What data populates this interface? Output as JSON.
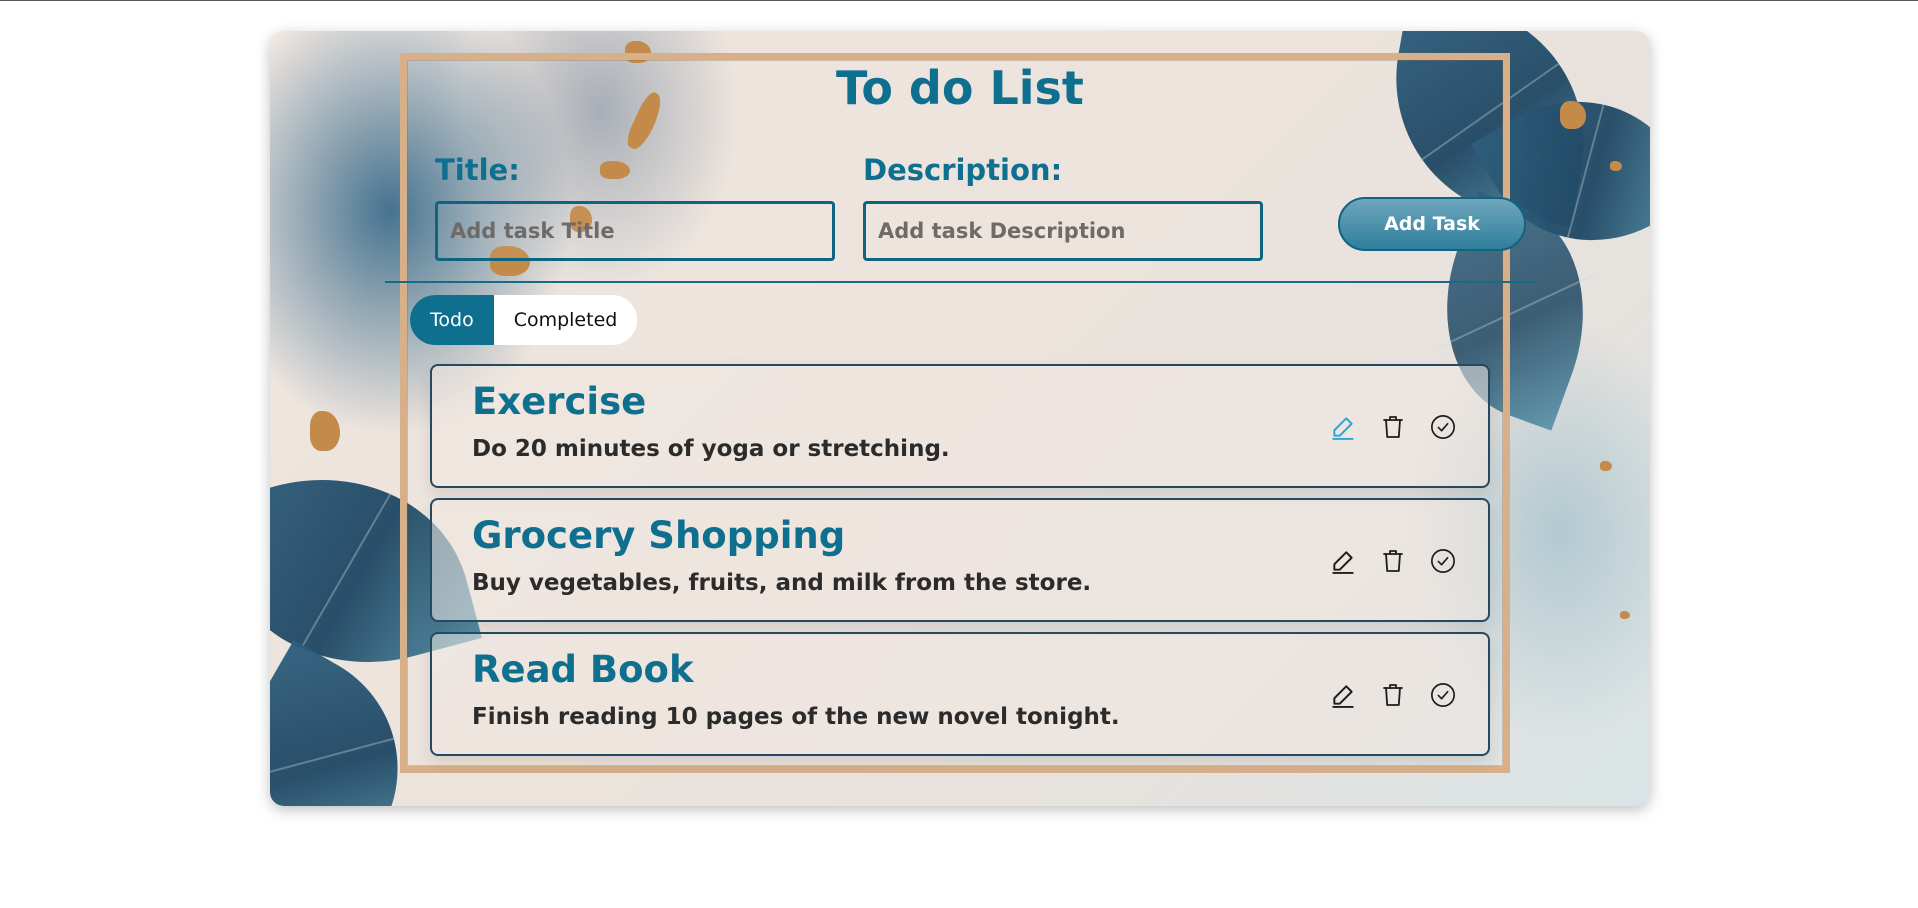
{
  "app": {
    "title": "To do List"
  },
  "form": {
    "title_label": "Title:",
    "title_placeholder": "Add task Title",
    "description_label": "Description:",
    "description_placeholder": "Add task Description",
    "add_button_label": "Add Task"
  },
  "tabs": [
    {
      "label": "Todo",
      "active": true
    },
    {
      "label": "Completed",
      "active": false
    }
  ],
  "tasks": [
    {
      "title": "Exercise",
      "description": "Do 20 minutes of yoga or stretching.",
      "actions": [
        "edit-icon",
        "trash-icon",
        "check-circle-icon"
      ]
    },
    {
      "title": "Grocery Shopping",
      "description": "Buy vegetables, fruits, and milk from the store.",
      "actions": [
        "edit-icon",
        "trash-icon",
        "check-circle-icon"
      ]
    },
    {
      "title": "Read Book",
      "description": "Finish reading 10 pages of the new novel tonight.",
      "actions": [
        "edit-icon",
        "trash-icon",
        "check-circle-icon"
      ]
    }
  ],
  "colors": {
    "accent": "#0f6f8f",
    "border": "#0f6480",
    "frame": "#d7b08a",
    "edit_highlight": "#2aa6d6"
  }
}
